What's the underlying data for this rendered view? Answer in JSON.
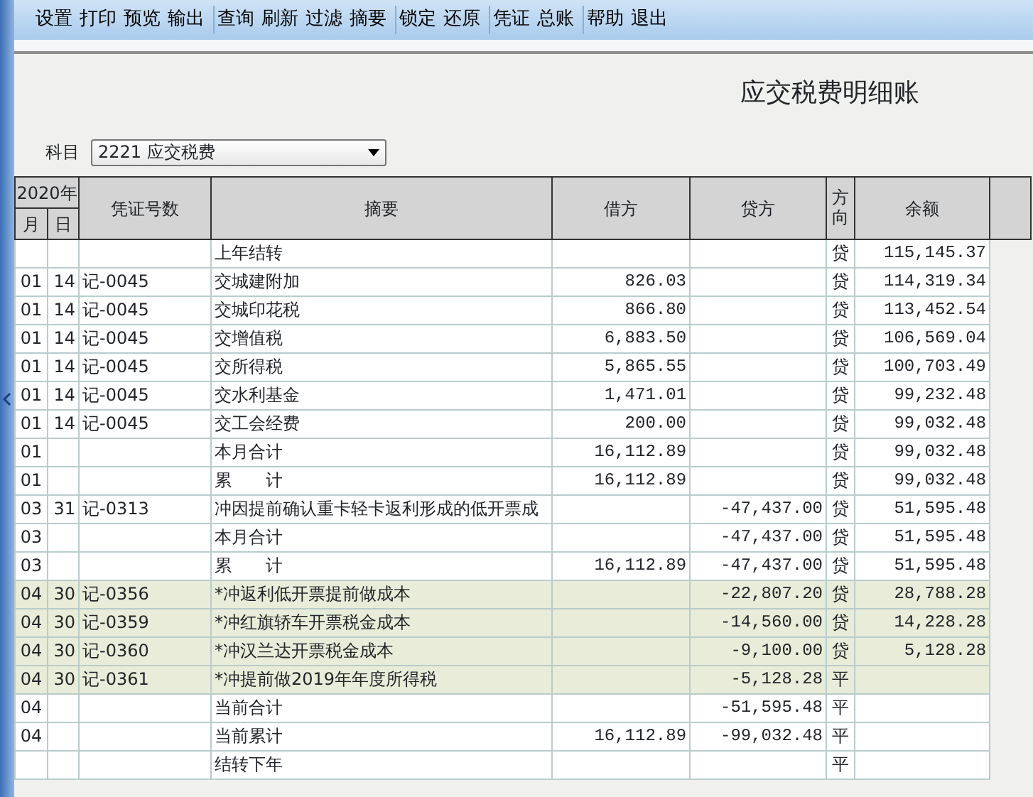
{
  "toolbar": [
    [
      "设置",
      "打印",
      "预览",
      "输出"
    ],
    [
      "查询",
      "刷新",
      "过滤",
      "摘要"
    ],
    [
      "锁定",
      "还原"
    ],
    [
      "凭证",
      "总账"
    ],
    [
      "帮助",
      "退出"
    ]
  ],
  "title": "应交税费明细账",
  "subject": {
    "label": "科目",
    "value": "2221 应交税费"
  },
  "table": {
    "year_header": "2020年",
    "columns": [
      "月",
      "日",
      "凭证号数",
      "摘要",
      "借方",
      "贷方",
      "方向",
      "余额"
    ],
    "rows": [
      {
        "summary": "上年结转",
        "direction": "贷",
        "balance": "115,145.37",
        "highlighted": false
      },
      {
        "month": "01",
        "day": "14",
        "voucher": "记-0045",
        "summary": "交城建附加",
        "debit": "826.03",
        "direction": "贷",
        "balance": "114,319.34",
        "highlighted": false
      },
      {
        "month": "01",
        "day": "14",
        "voucher": "记-0045",
        "summary": "交城印花税",
        "debit": "866.80",
        "direction": "贷",
        "balance": "113,452.54",
        "highlighted": false
      },
      {
        "month": "01",
        "day": "14",
        "voucher": "记-0045",
        "summary": "交增值税",
        "debit": "6,883.50",
        "direction": "贷",
        "balance": "106,569.04",
        "highlighted": false
      },
      {
        "month": "01",
        "day": "14",
        "voucher": "记-0045",
        "summary": "交所得税",
        "debit": "5,865.55",
        "direction": "贷",
        "balance": "100,703.49",
        "highlighted": false
      },
      {
        "month": "01",
        "day": "14",
        "voucher": "记-0045",
        "summary": "交水利基金",
        "debit": "1,471.01",
        "direction": "贷",
        "balance": "99,232.48",
        "highlighted": false
      },
      {
        "month": "01",
        "day": "14",
        "voucher": "记-0045",
        "summary": "交工会经费",
        "debit": "200.00",
        "direction": "贷",
        "balance": "99,032.48",
        "highlighted": false
      },
      {
        "month": "01",
        "summary": "本月合计",
        "debit": "16,112.89",
        "direction": "贷",
        "balance": "99,032.48",
        "highlighted": false
      },
      {
        "month": "01",
        "summary": "累　　计",
        "debit": "16,112.89",
        "direction": "贷",
        "balance": "99,032.48",
        "highlighted": false
      },
      {
        "month": "03",
        "day": "31",
        "voucher": "记-0313",
        "summary": "冲因提前确认重卡轻卡返利形成的低开票成",
        "credit": "-47,437.00",
        "direction": "贷",
        "balance": "51,595.48",
        "highlighted": false
      },
      {
        "month": "03",
        "summary": "本月合计",
        "credit": "-47,437.00",
        "direction": "贷",
        "balance": "51,595.48",
        "highlighted": false
      },
      {
        "month": "03",
        "summary": "累　　计",
        "debit": "16,112.89",
        "credit": "-47,437.00",
        "direction": "贷",
        "balance": "51,595.48",
        "highlighted": false
      },
      {
        "month": "04",
        "day": "30",
        "voucher": "记-0356",
        "summary": "*冲返利低开票提前做成本",
        "credit": "-22,807.20",
        "direction": "贷",
        "balance": "28,788.28",
        "highlighted": true
      },
      {
        "month": "04",
        "day": "30",
        "voucher": "记-0359",
        "summary": "*冲红旗轿车开票税金成本",
        "credit": "-14,560.00",
        "direction": "贷",
        "balance": "14,228.28",
        "highlighted": true
      },
      {
        "month": "04",
        "day": "30",
        "voucher": "记-0360",
        "summary": "*冲汉兰达开票税金成本",
        "credit": "-9,100.00",
        "direction": "贷",
        "balance": "5,128.28",
        "highlighted": true
      },
      {
        "month": "04",
        "day": "30",
        "voucher": "记-0361",
        "summary": "*冲提前做2019年年度所得税",
        "credit": "-5,128.28",
        "direction": "平",
        "highlighted": true
      },
      {
        "month": "04",
        "summary": "当前合计",
        "credit": "-51,595.48",
        "direction": "平",
        "highlighted": false
      },
      {
        "month": "04",
        "summary": "当前累计",
        "debit": "16,112.89",
        "credit": "-99,032.48",
        "direction": "平",
        "highlighted": false
      },
      {
        "summary": "结转下年",
        "direction": "平",
        "highlighted": false
      }
    ]
  }
}
